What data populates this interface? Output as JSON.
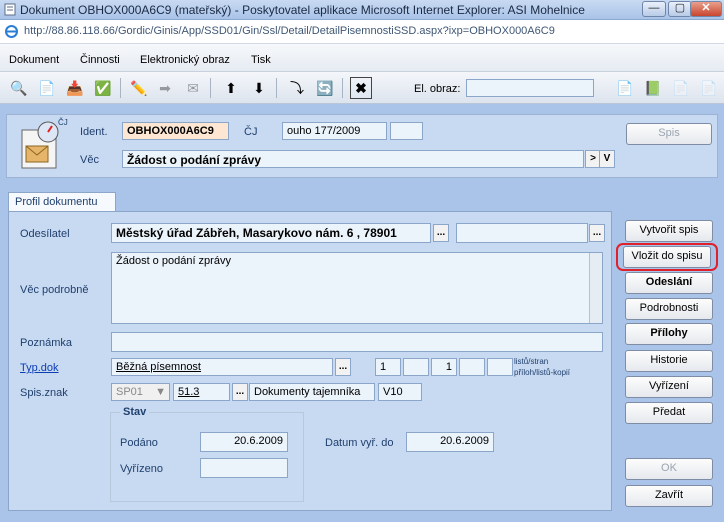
{
  "window": {
    "title": "Dokument OBHOX000A6C9 (mateřský) - Poskytovatel aplikace Microsoft Internet Explorer: ASI Mohelnice",
    "url": "http://88.86.118.66/Gordic/Ginis/App/SSD01/Gin/Ssl/Detail/DetailPisemnostiSSD.aspx?ixp=OBHOX000A6C9"
  },
  "menu": {
    "items": [
      "Dokument",
      "Činnosti",
      "Elektronický obraz",
      "Tisk"
    ]
  },
  "toolbar": {
    "el_obraz_label": "El. obraz:",
    "el_obraz_value": ""
  },
  "header": {
    "ident_label": "Ident.",
    "ident_value": "OBHOX000A6C9",
    "cj_label": "ČJ",
    "cj_value": "ouho 177/2009",
    "cj_extra": "",
    "vec_label": "Věc",
    "vec_value": "Žádost o podání zprávy",
    "badge": "ČJ",
    "spis_button": "Spis",
    "arrow_btn": ">",
    "v_btn": "V"
  },
  "tab": {
    "label": "Profil dokumentu"
  },
  "form": {
    "odesilatel_label": "Odesílatel",
    "odesilatel_value": "Městský úřad Zábřeh, Masarykovo nám. 6 , 78901",
    "odesilatel_extra": "",
    "vec_podrobne_label": "Věc podrobně",
    "vec_podrobne_value": "Žádost o podání zprávy",
    "poznamka_label": "Poznámka",
    "poznamka_value": "",
    "typ_dok_label": "Typ.dok",
    "typ_dok_value": "Běžná písemnost",
    "count1": "1",
    "count2": "",
    "count3": "1",
    "count4": "",
    "count5": "",
    "listu_label_1": "listů/stran",
    "listu_label_2": "příloh/listů-kopií",
    "spis_znak_label": "Spis.znak",
    "spis_znak_select": "SP01",
    "spis_znak_value": "51.3",
    "spis_znak_desc": "Dokumenty tajemníka",
    "spis_znak_code": "V10",
    "ellipsis": "..."
  },
  "stav": {
    "legend": "Stav",
    "podano_label": "Podáno",
    "podano_value": "20.6.2009",
    "vyrizeno_label": "Vyřízeno",
    "vyrizeno_value": "",
    "datum_vyr_label": "Datum vyř. do",
    "datum_vyr_value": "20.6.2009"
  },
  "side_buttons": {
    "vytvorit_spis": "Vytvořit spis",
    "vlozit_do_spisu": "Vložit do spisu",
    "odeslani": "Odeslání",
    "podrobnosti": "Podrobnosti",
    "prilohy": "Přílohy",
    "historie": "Historie",
    "vyrizeni": "Vyřízení",
    "predat": "Předat",
    "ok": "OK",
    "zavrit": "Zavřít"
  },
  "colors": {
    "highlight_ring": "#e0202b",
    "panel_bg": "#c8daf1",
    "field_bg": "#ebf3fb",
    "ident_bg": "#fde7d2"
  }
}
